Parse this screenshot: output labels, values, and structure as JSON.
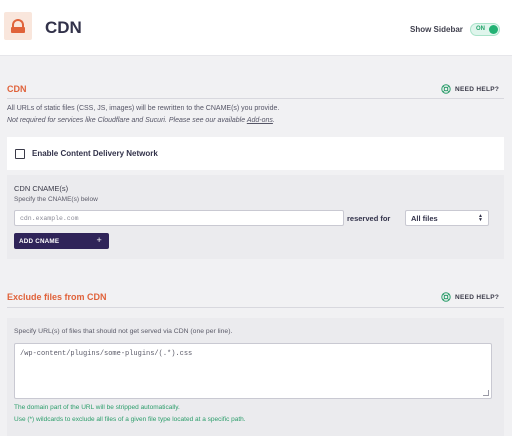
{
  "header": {
    "title": "CDN",
    "sidebar_label": "Show Sidebar",
    "toggle_label": "ON"
  },
  "help_label": "NEED HELP?",
  "cdn": {
    "section_title": "CDN",
    "description": "All URLs of static files (CSS, JS, images) will be rewritten to the CNAME(s) you provide.",
    "note_prefix": "Not required for services like Cloudflare and Sucuri. Please see our available ",
    "note_link": "Add-ons",
    "note_suffix": ".",
    "enable_label": "Enable Content Delivery Network",
    "enable_checked": false,
    "cname_label": "CDN CNAME(s)",
    "cname_hint": "Specify the CNAME(s) below",
    "cname_placeholder": "cdn.example.com",
    "reserved_label": "reserved for",
    "reserved_value": "All files",
    "add_button": "ADD CNAME",
    "add_plus": "+"
  },
  "exclude": {
    "section_title": "Exclude files from CDN",
    "hint": "Specify URL(s) of files that should not get served via CDN (one per line).",
    "textarea_placeholder": "/wp-content/plugins/some-plugins/(.*).css",
    "note1": "The domain part of the URL will be stripped automatically.",
    "note2": "Use (*) wildcards to exclude all files of a given file type located at a specific path."
  },
  "colors": {
    "accent": "#e0623a",
    "primary": "#2f2459",
    "success": "#23b274"
  },
  "icons": {
    "logo": "rocket-house-logo",
    "help": "lifebuoy-icon",
    "checkbox": "checkbox-icon"
  }
}
